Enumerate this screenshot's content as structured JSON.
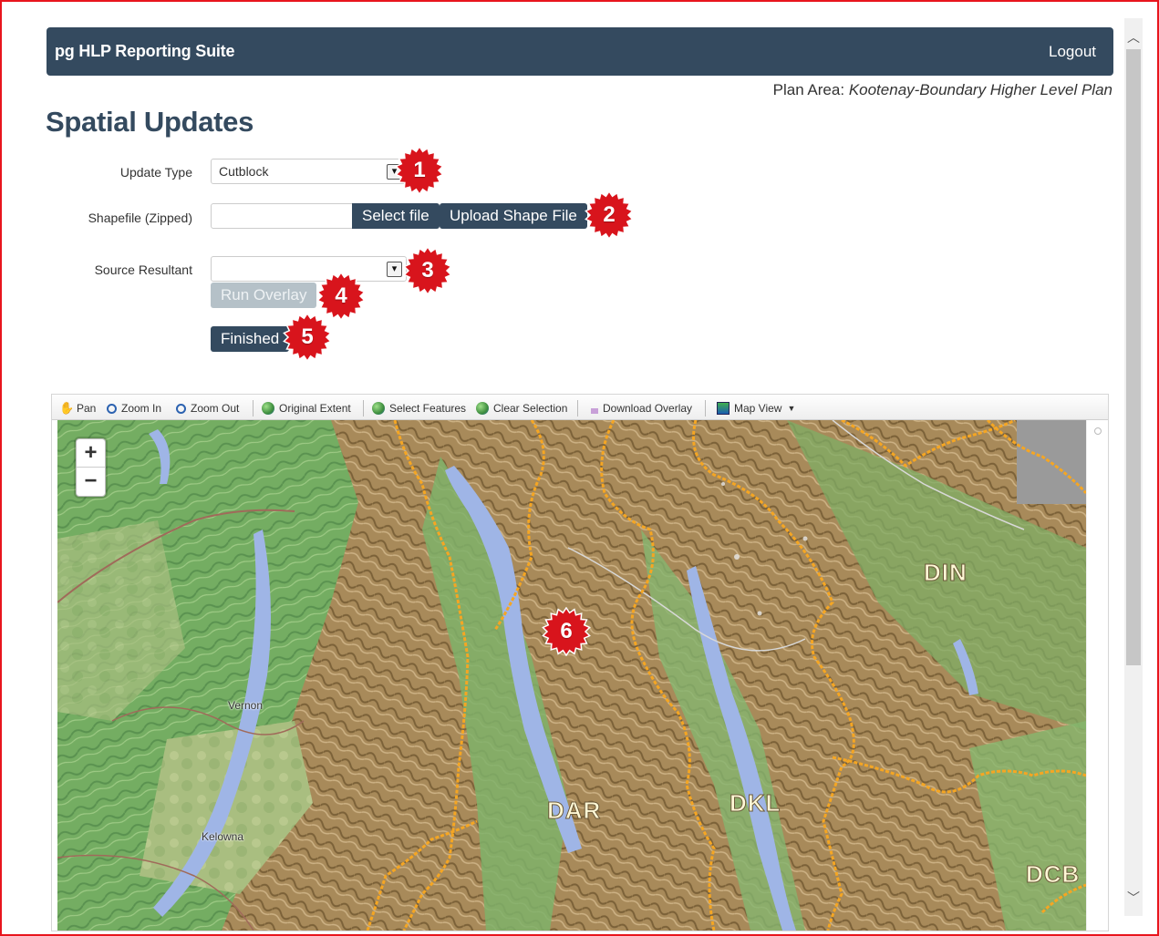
{
  "navbar": {
    "brand": "pg HLP Reporting Suite",
    "logout": "Logout"
  },
  "plan_area": {
    "label": "Plan Area:",
    "value": "Kootenay-Boundary Higher Level Plan"
  },
  "page_title": "Spatial Updates",
  "form": {
    "update_type_label": "Update Type",
    "update_type_value": "Cutblock",
    "shapefile_label": "Shapefile (Zipped)",
    "select_file": "Select file",
    "upload_shape": "Upload Shape File",
    "source_resultant_label": "Source Resultant",
    "source_resultant_value": "",
    "run_overlay": "Run Overlay",
    "finished": "Finished"
  },
  "badges": [
    "1",
    "2",
    "3",
    "4",
    "5",
    "6"
  ],
  "toolbar": {
    "pan": "Pan",
    "zoom_in": "Zoom In",
    "zoom_out": "Zoom Out",
    "original_extent": "Original Extent",
    "select_features": "Select Features",
    "clear_selection": "Clear Selection",
    "download_overlay": "Download Overlay",
    "map_view": "Map View"
  },
  "map": {
    "zoom_in": "+",
    "zoom_out": "−",
    "regions": [
      "DIN",
      "DAR",
      "DKL",
      "DCB"
    ],
    "cities": [
      "Vernon",
      "Kelowna"
    ]
  },
  "icons": {
    "caret": "chevron-down-icon",
    "pan": "hand-icon",
    "zoom_in": "zoom-in-icon",
    "zoom_out": "zoom-out-icon",
    "globe": "globe-icon",
    "download": "download-icon",
    "map_view": "map-view-icon",
    "scroll_up": "scroll-up-arrow",
    "scroll_down": "scroll-down-arrow"
  },
  "colors": {
    "navbar": "#344a5f",
    "title": "#344a5f",
    "badge": "#d8141c",
    "frame": "#e8151d",
    "boundary": "#f5a623",
    "water": "#9fb5e6"
  }
}
